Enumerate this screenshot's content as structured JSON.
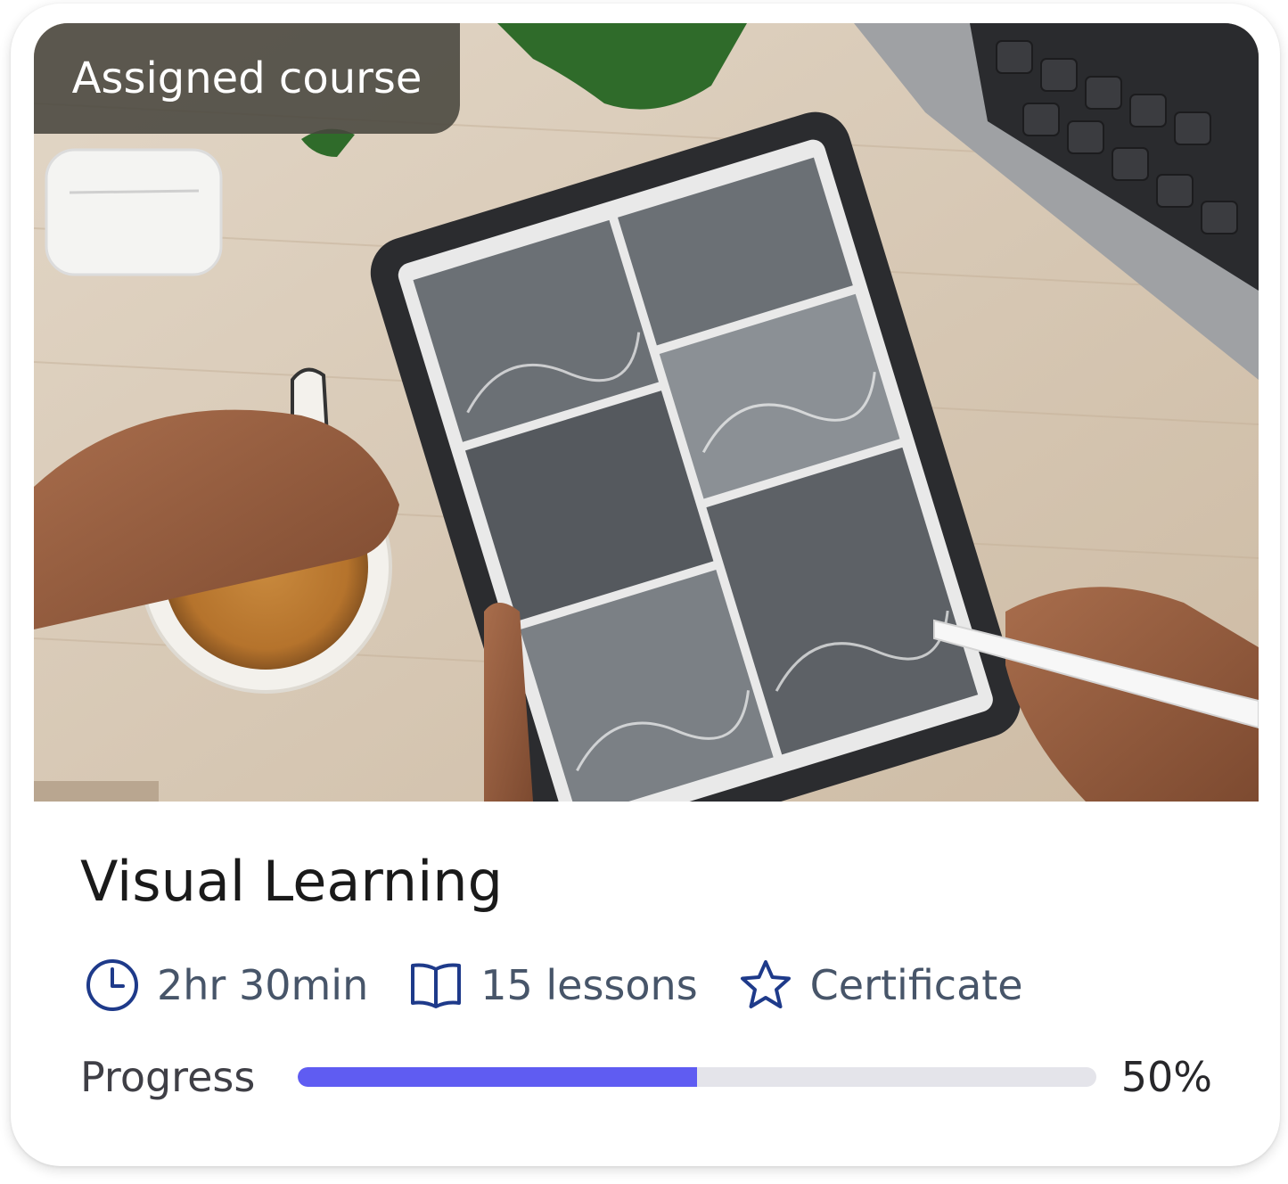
{
  "card": {
    "badge": "Assigned course",
    "title": "Visual Learning",
    "meta": [
      {
        "icon": "clock-icon",
        "text": "2hr 30min"
      },
      {
        "icon": "book-icon",
        "text": "15 lessons"
      },
      {
        "icon": "star-icon",
        "text": "Certificate"
      }
    ],
    "progress": {
      "label": "Progress",
      "value_text": "50%",
      "fraction": 0.5
    }
  },
  "colors": {
    "accent": "#5f5cf2",
    "icon": "#1e3a8a",
    "meta_text": "#475569"
  }
}
